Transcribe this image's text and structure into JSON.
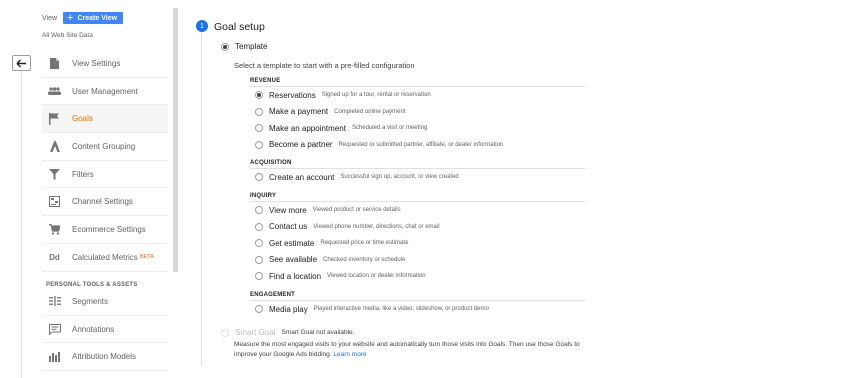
{
  "colors": {
    "accent_blue": "#4285f4",
    "active_orange": "#e8710a",
    "step_blue": "#1a73e8"
  },
  "sidebar": {
    "view_label": "View",
    "create_view_label": "Create View",
    "view_name": "All Web Site Data",
    "items": [
      {
        "label": "View Settings",
        "icon": "document-icon"
      },
      {
        "label": "User Management",
        "icon": "users-icon"
      },
      {
        "label": "Goals",
        "icon": "flag-icon",
        "active": true
      },
      {
        "label": "Content Grouping",
        "icon": "content-grouping-icon"
      },
      {
        "label": "Filters",
        "icon": "filter-icon"
      },
      {
        "label": "Channel Settings",
        "icon": "channel-settings-icon"
      },
      {
        "label": "Ecommerce Settings",
        "icon": "cart-icon"
      },
      {
        "label": "Calculated Metrics",
        "icon": "dd-icon",
        "badge": "BETA"
      }
    ],
    "section_header": "PERSONAL TOOLS & ASSETS",
    "tools": [
      {
        "label": "Segments",
        "icon": "segments-icon"
      },
      {
        "label": "Annotations",
        "icon": "annotations-icon"
      },
      {
        "label": "Attribution Models",
        "icon": "bar-chart-icon"
      }
    ]
  },
  "goal_setup": {
    "step_number": "1",
    "title": "Goal setup",
    "template_label": "Template",
    "select_text": "Select a template to start with a pre-filled configuration",
    "categories": [
      {
        "name": "REVENUE",
        "options": [
          {
            "label": "Reservations",
            "desc": "Signed up for a tour, rental or reservation",
            "selected": true
          },
          {
            "label": "Make a payment",
            "desc": "Completed online payment"
          },
          {
            "label": "Make an appointment",
            "desc": "Scheduled a visit or meeting"
          },
          {
            "label": "Become a partner",
            "desc": "Requested or submitted partner, affiliate, or dealer information"
          }
        ]
      },
      {
        "name": "ACQUISITION",
        "options": [
          {
            "label": "Create an account",
            "desc": "Successful sign up, account, or view created"
          }
        ]
      },
      {
        "name": "INQUIRY",
        "options": [
          {
            "label": "View more",
            "desc": "Viewed product or service details"
          },
          {
            "label": "Contact us",
            "desc": "Viewed phone number, directions, chat or email"
          },
          {
            "label": "Get estimate",
            "desc": "Requested price or time estimate"
          },
          {
            "label": "See available",
            "desc": "Checked inventory or schedule"
          },
          {
            "label": "Find a location",
            "desc": "Viewed location or dealer information"
          }
        ]
      },
      {
        "name": "ENGAGEMENT",
        "options": [
          {
            "label": "Media play",
            "desc": "Played interactive media, like a video, slideshow, or product demo"
          }
        ]
      }
    ],
    "smart_goal_label": "Smart Goal",
    "smart_goal_status": "Smart Goal not available.",
    "smart_goal_desc": "Measure the most engaged visits to your website and automatically turn those visits into Goals. Then use those Goals to improve your Google Ads bidding.",
    "learn_more": "Learn more"
  }
}
